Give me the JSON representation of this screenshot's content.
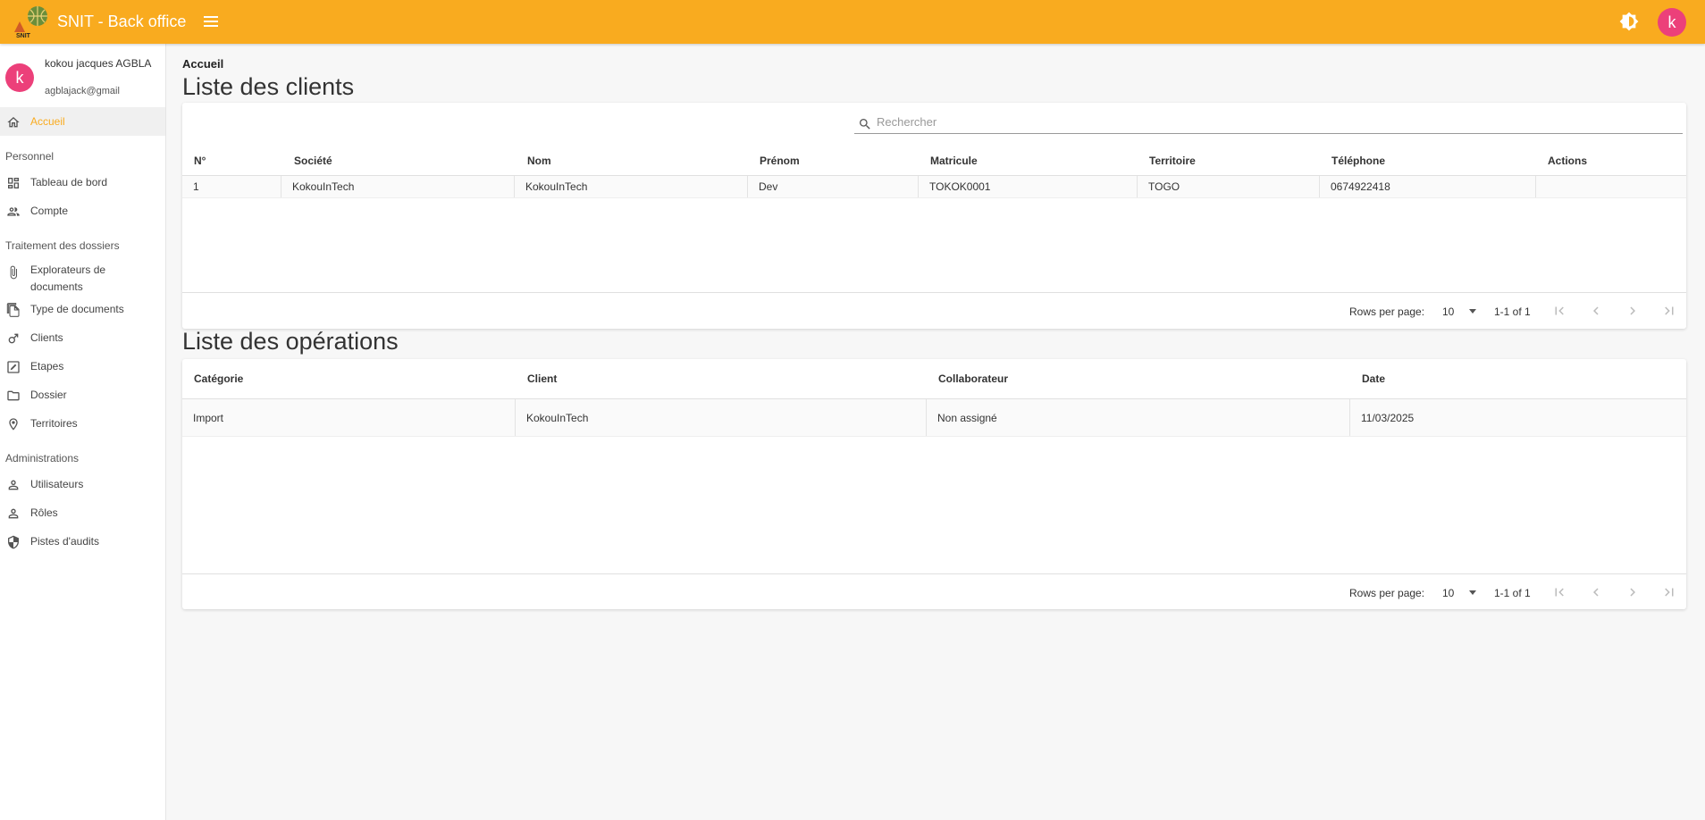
{
  "app": {
    "title": "SNIT - Back office",
    "logo_text": "SNIT"
  },
  "user": {
    "avatar_letter": "k",
    "name": "kokou jacques AGBLA",
    "email": "agblajack@gmail"
  },
  "sidebar": {
    "home": {
      "label": "Accueil",
      "icon": "home-icon"
    },
    "sections": [
      {
        "title": "Personnel",
        "items": [
          {
            "label": "Tableau de bord",
            "icon": "dashboard-icon"
          },
          {
            "label": "Compte",
            "icon": "account-icon"
          }
        ]
      },
      {
        "title": "Traitement des dossiers",
        "items": [
          {
            "label": "Explorateurs de documents",
            "icon": "paperclip-icon"
          },
          {
            "label": "Type de documents",
            "icon": "copy-icon"
          },
          {
            "label": "Clients",
            "icon": "male-icon"
          },
          {
            "label": "Etapes",
            "icon": "edit-square-icon"
          },
          {
            "label": "Dossier",
            "icon": "folder-icon"
          },
          {
            "label": "Territoires",
            "icon": "location-pin-icon"
          }
        ]
      },
      {
        "title": "Administrations",
        "items": [
          {
            "label": "Utilisateurs",
            "icon": "person-icon"
          },
          {
            "label": "Rôles",
            "icon": "person-icon"
          },
          {
            "label": "Pistes d'audits",
            "icon": "shield-icon"
          }
        ]
      }
    ]
  },
  "breadcrumb": "Accueil",
  "clients": {
    "title": "Liste des clients",
    "search_placeholder": "Rechercher",
    "columns": [
      "N°",
      "Société",
      "Nom",
      "Prénom",
      "Matricule",
      "Territoire",
      "Téléphone",
      "Actions"
    ],
    "rows": [
      [
        "1",
        "KokouInTech",
        "KokouInTech",
        "Dev",
        "TOKOK0001",
        "TOGO",
        "0674922418",
        ""
      ]
    ],
    "pager": {
      "rows_per_page_label": "Rows per page:",
      "rows_per_page": "10",
      "range": "1-1 of 1"
    }
  },
  "operations": {
    "title": "Liste des opérations",
    "columns": [
      "Catégorie",
      "Client",
      "Collaborateur",
      "Date"
    ],
    "rows": [
      [
        "Import",
        "KokouInTech",
        "Non assigné",
        "11/03/2025"
      ]
    ],
    "pager": {
      "rows_per_page_label": "Rows per page:",
      "rows_per_page": "10",
      "range": "1-1 of 1"
    }
  },
  "colors": {
    "primary": "#f9ab1f",
    "avatar": "#ec407a",
    "active_text": "#f9ab1f"
  }
}
